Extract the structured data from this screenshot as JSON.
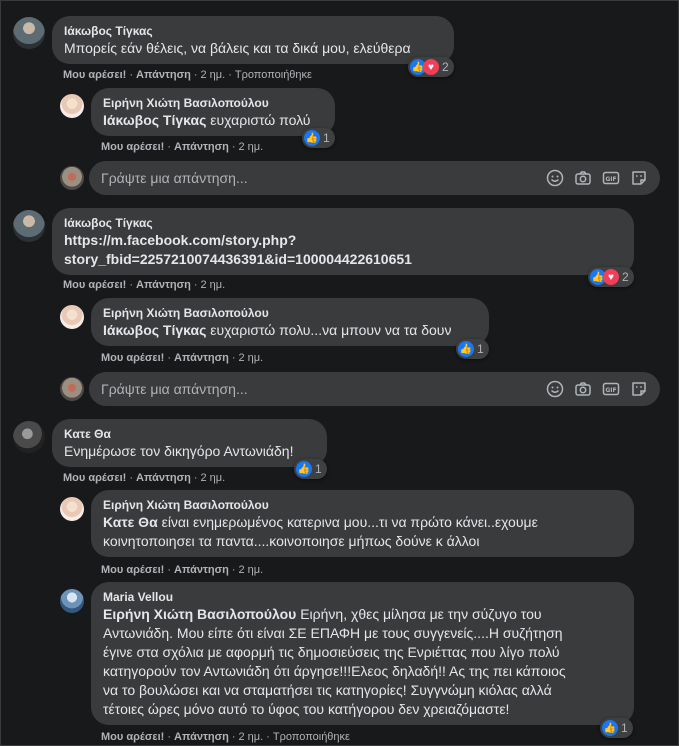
{
  "ui": {
    "like_label": "Μου αρέσει!",
    "reply_label": "Απάντηση",
    "reply_placeholder": "Γράψτε μια απάντηση...",
    "dot": "·"
  },
  "comments": [
    {
      "author": "Ιάκωβος Τίγκας",
      "text": "Μπορείς εάν θέλεις, να βάλεις και τα δικά μου, ελεύθερα",
      "time": "2 ημ.",
      "edited": "Τροποποιήθηκε",
      "reaction_count": "2",
      "replies": [
        {
          "author": "Ειρήνη Χιώτη Βασιλοπούλου",
          "mention": "Ιάκωβος Τίγκας",
          "text": " ευχαριστώ πολύ",
          "time": "2 ημ.",
          "reaction_count": "1"
        }
      ]
    },
    {
      "author": "Ιάκωβος Τίγκας",
      "text": "https://m.facebook.com/story.php?\nstory_fbid=2257210074436391&id=100004422610651",
      "time": "2 ημ.",
      "reaction_count": "2",
      "replies": [
        {
          "author": "Ειρήνη Χιώτη Βασιλοπούλου",
          "mention": "Ιάκωβος Τίγκας",
          "text": " ευχαριστώ πολυ...να μπουν να τα δουν",
          "time": "2 ημ.",
          "reaction_count": "1"
        }
      ]
    },
    {
      "author": "Κατε Θα",
      "text": "Ενημέρωσε τον δικηγόρο Αντωνιάδη!",
      "time": "2 ημ.",
      "reaction_count": "1",
      "replies": [
        {
          "author": "Ειρήνη Χιώτη Βασιλοπούλου",
          "mention": "Κατε Θα",
          "text": " είναι ενημερωμένος κατερινα μου...τι να πρώτο κάνει..εχουμε\nκοινητοποιησει τα παντα....κοινοποιησε μήπως δούνε κ άλλοι",
          "time": "2 ημ."
        },
        {
          "author": "Maria Vellou",
          "mention": "Ειρήνη Χιώτη Βασιλοπούλου",
          "text": " Ειρήνη, χθες μίλησα με την σύζυγο του\nΑντωνιάδη. Μου είπε ότι είναι ΣΕ ΕΠΑΦΗ με τους συγγενείς....Η συζήτηση\nέγινε στα σχόλια με αφορμή τις δημοσιεύσεις της Ενριέττας που λίγο πολύ\nκατηγορούν τον Αντωνιάδη ότι άργησε!!!Ελεος δηλαδή!! Ας της πει κάποιος\nνα το βουλώσει και να σταματήσει τις κατηγορίες! Συγγνώμη κιόλας αλλά\nτέτοιες ώρες μόνο αυτό το ύφος του κατήγορου δεν χρειαζόμαστε!",
          "time": "2 ημ.",
          "edited": "Τροποποιήθηκε",
          "reaction_count": "1"
        }
      ]
    }
  ]
}
